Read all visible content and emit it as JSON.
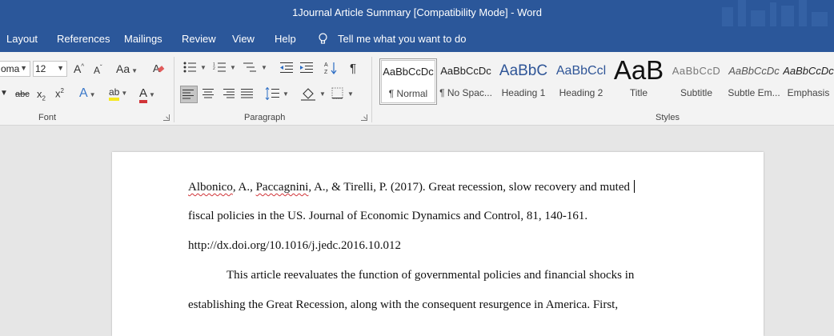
{
  "window": {
    "title": "1Journal Article Summary [Compatibility Mode]  -  Word"
  },
  "ribbon_tabs": [
    "Layout",
    "References",
    "Mailings",
    "Review",
    "View",
    "Help"
  ],
  "tell_me": {
    "placeholder": "Tell me what you want to do",
    "icon": "lightbulb-icon"
  },
  "font": {
    "name": "oma",
    "size": "12",
    "group_label": "Font",
    "grow": "A",
    "shrink": "A",
    "change_case": "Aa",
    "strike": "abc",
    "subscript": "x",
    "superscript": "x",
    "sub_mark": "2",
    "sup_mark": "2",
    "effects": "A",
    "highlight": "ab",
    "color": "A",
    "highlight_color": "#f6e81e",
    "font_color": "#d13438"
  },
  "paragraph": {
    "group_label": "Paragraph",
    "pilcrow": "¶"
  },
  "styles": {
    "group_label": "Styles",
    "items": [
      {
        "preview": "AaBbCcDc",
        "name": "¶ Normal"
      },
      {
        "preview": "AaBbCcDc",
        "name": "¶ No Spac..."
      },
      {
        "preview": "AaBbC",
        "name": "Heading 1"
      },
      {
        "preview": "AaBbCcl",
        "name": "Heading 2"
      },
      {
        "preview": "AaB",
        "name": "Title"
      },
      {
        "preview": "AaBbCcD",
        "name": "Subtitle"
      },
      {
        "preview": "AaBbCcDc",
        "name": "Subtle Em..."
      },
      {
        "preview": "AaBbCcDc",
        "name": "Emphasis"
      }
    ]
  },
  "document": {
    "citation_authors": {
      "a1": "Albonico",
      "sep1": ", A., ",
      "a2": "Paccagnini",
      "rest": ", A., & Tirelli, P. (2017). Great recession, slow recovery and muted"
    },
    "lines": [
      "fiscal policies in the US. Journal of Economic Dynamics and Control, 81, 140-161.",
      "http://dx.doi.org/10.1016/j.jedc.2016.10.012",
      "This article reevaluates the function of governmental policies and financial shocks in",
      "establishing the Great Recession, along with the consequent resurgence in America. First,"
    ]
  }
}
